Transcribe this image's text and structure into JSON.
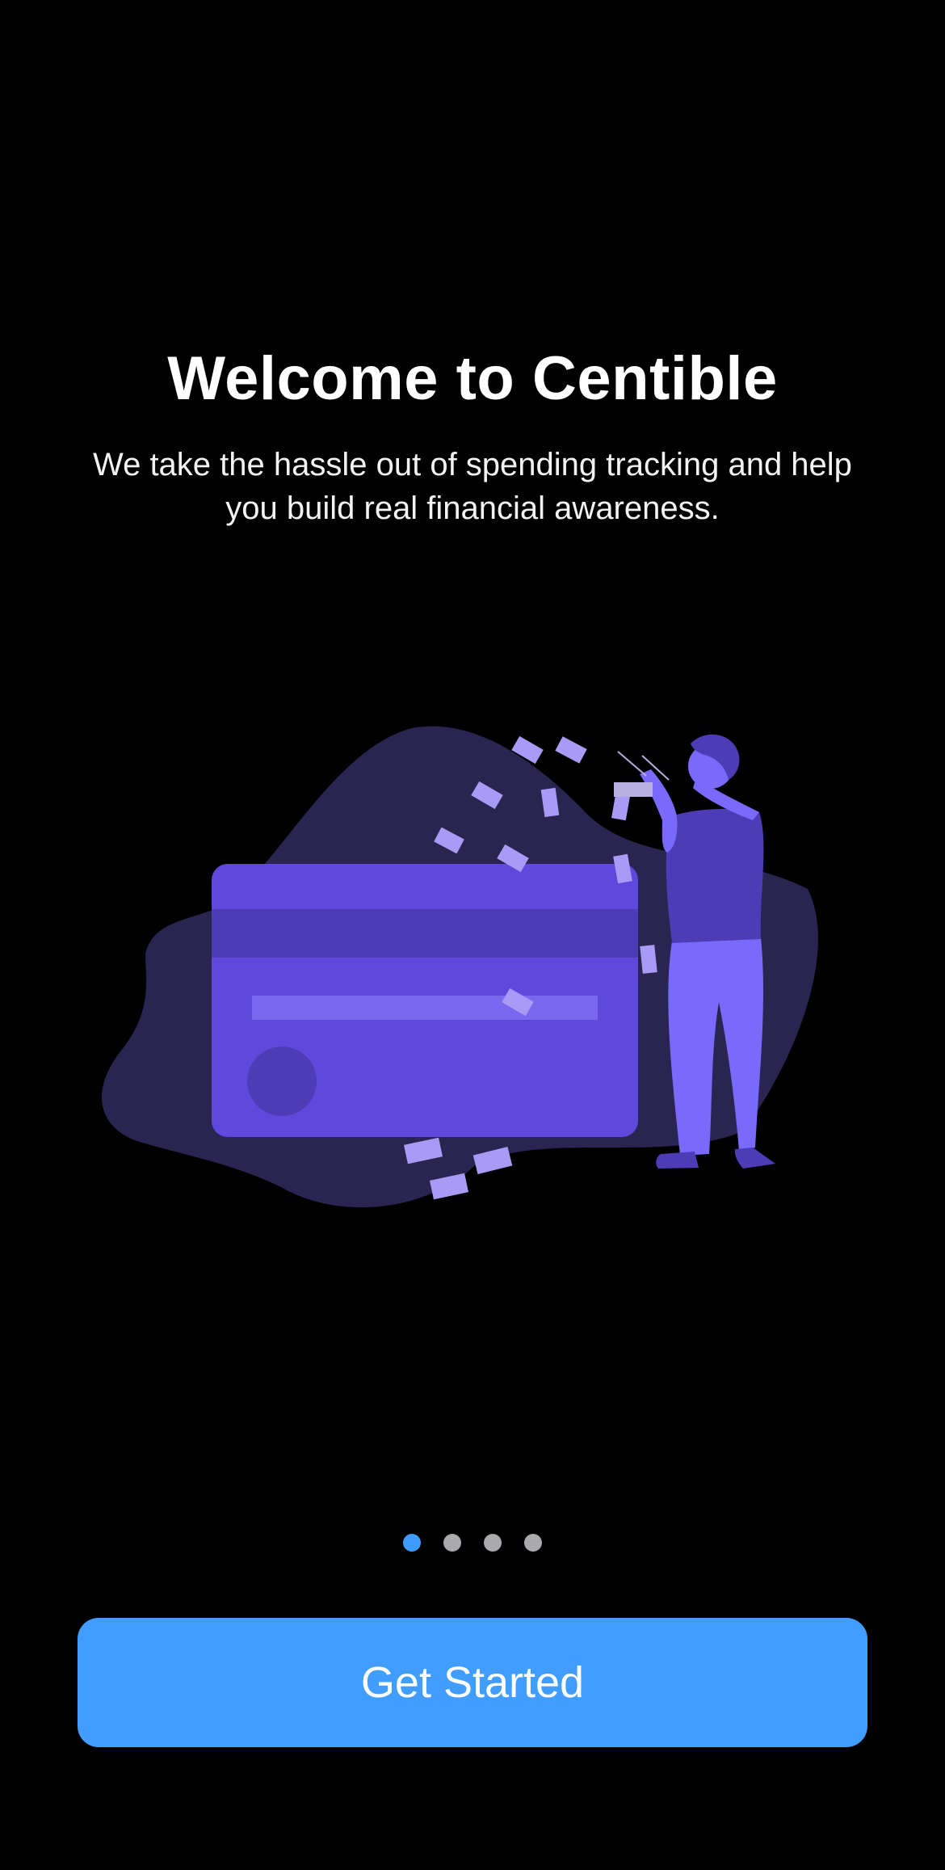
{
  "onboarding": {
    "title": "Welcome to Centible",
    "subtitle": "We take the hassle out of spending tracking and help you build real financial awareness.",
    "illustration_icon": "credit-card-person-illustration",
    "pager": {
      "total": 4,
      "active": 1
    },
    "cta_label": "Get Started"
  },
  "colors": {
    "background": "#000000",
    "accent": "#419dff",
    "card": "#6148dc",
    "blob": "#2a2550",
    "person_light": "#7a6afc",
    "person_dark": "#4d3cb5",
    "inactive_dot": "#a9a9ae"
  }
}
